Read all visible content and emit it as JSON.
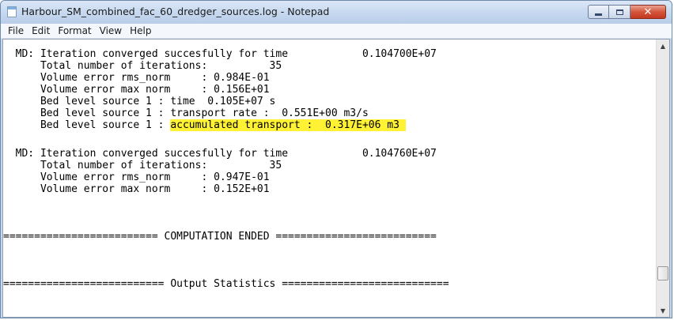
{
  "window": {
    "title": "Harbour_SM_combined_fac_60_dredger_sources.log - Notepad",
    "minimize_icon": "minimize-icon",
    "maximize_icon": "maximize-icon",
    "close_icon": "close-icon",
    "close_color": "#c9412a"
  },
  "menu": {
    "file": "File",
    "edit": "Edit",
    "format": "Format",
    "view": "View",
    "help": "Help"
  },
  "log": {
    "highlight_color": "#fff234",
    "lines": [
      {
        "text": "  MD: Iteration converged succesfully for time            0.104700E+07"
      },
      {
        "text": "      Total number of iterations:          35"
      },
      {
        "text": "      Volume error rms_norm     : 0.984E-01"
      },
      {
        "text": "      Volume error max norm     : 0.156E+01"
      },
      {
        "text": "      Bed level source 1 : time  0.105E+07 s"
      },
      {
        "text": "      Bed level source 1 : transport rate :  0.551E+00 m3/s"
      },
      {
        "prefix": "      Bed level source 1 : ",
        "highlight": "accumulated transport :  0.317E+06 m3 "
      },
      {
        "text": ""
      },
      {
        "text": "  MD: Iteration converged succesfully for time            0.104760E+07"
      },
      {
        "text": "      Total number of iterations:          35"
      },
      {
        "text": "      Volume error rms_norm     : 0.947E-01"
      },
      {
        "text": "      Volume error max norm     : 0.152E+01"
      },
      {
        "text": ""
      },
      {
        "text": ""
      },
      {
        "text": ""
      },
      {
        "text": "========================= COMPUTATION ENDED =========================="
      },
      {
        "text": ""
      },
      {
        "text": ""
      },
      {
        "text": ""
      },
      {
        "text": "========================== Output Statistics ==========================="
      }
    ]
  },
  "scrollbar": {
    "up_arrow_icon": "scroll-up-arrow-icon",
    "down_arrow_icon": "scroll-down-arrow-icon",
    "position": 0.9
  }
}
